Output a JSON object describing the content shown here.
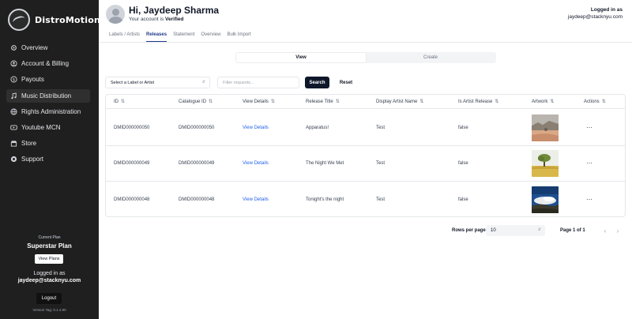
{
  "app": {
    "name": "DistroMotion",
    "logo_icon": "record-disc-icon"
  },
  "sidebar": {
    "items": [
      {
        "label": "Overview",
        "icon": "gear-icon",
        "active": false
      },
      {
        "label": "Account & Billing",
        "icon": "account-icon",
        "active": false
      },
      {
        "label": "Payouts",
        "icon": "dollar-icon",
        "active": false
      },
      {
        "label": "Music Distribution",
        "icon": "music-note-icon",
        "active": true
      },
      {
        "label": "Rights Administration",
        "icon": "globe-icon",
        "active": false
      },
      {
        "label": "Youtube MCN",
        "icon": "youtube-icon",
        "active": false
      },
      {
        "label": "Store",
        "icon": "store-icon",
        "active": false
      },
      {
        "label": "Support",
        "icon": "support-icon",
        "active": false
      }
    ],
    "plan_caption": "Current Plan",
    "plan_name": "Superstar Plan",
    "view_plans_label": "View Plans",
    "logged_in_caption": "Logged in as",
    "logged_in_email": "jaydeep@stacknyu.com",
    "logout_label": "Logout",
    "version": "Version Tag: 0.1.4.90"
  },
  "header": {
    "greeting": "Hi, Jaydeep Sharma",
    "status_prefix": "Your account is ",
    "status_value": "Verified",
    "logged_in_caption": "Logged in as",
    "logged_in_email": "jaydeep@stacknyu.com"
  },
  "tabs": [
    {
      "label": "Labels / Artists",
      "active": false
    },
    {
      "label": "Releases",
      "active": true
    },
    {
      "label": "Statement",
      "active": false
    },
    {
      "label": "Overview",
      "active": false
    },
    {
      "label": "Bulk Import",
      "active": false
    }
  ],
  "segmented": {
    "view_label": "View",
    "create_label": "Create",
    "selected": "View"
  },
  "filters": {
    "select_value": "Select a Label or Artist",
    "search_placeholder": "Filter requests...",
    "search_value": "",
    "search_label": "Search",
    "reset_label": "Reset"
  },
  "table": {
    "columns": [
      {
        "label": "ID",
        "sortable": true
      },
      {
        "label": "Catalogue ID",
        "sortable": true
      },
      {
        "label": "View Details",
        "sortable": true
      },
      {
        "label": "Release Title",
        "sortable": true
      },
      {
        "label": "Display Artist Name",
        "sortable": true
      },
      {
        "label": "Is Artist Release",
        "sortable": true
      },
      {
        "label": "Artwork",
        "sortable": true
      },
      {
        "label": "Actions",
        "sortable": true
      }
    ],
    "rows": [
      {
        "id": "DMID000000050",
        "catalogue_id": "DMID000000050",
        "view_details": "View Details",
        "release_title": "Apparatus!",
        "artist": "Test",
        "is_artist_release": "false",
        "artwork": "desert-landscape",
        "actions": "⋯"
      },
      {
        "id": "DMID000000049",
        "catalogue_id": "DMID000000049",
        "view_details": "View Details",
        "release_title": "The Night We Met",
        "artist": "Test",
        "is_artist_release": "false",
        "artwork": "tree-in-field",
        "actions": "⋯"
      },
      {
        "id": "DMID000000048",
        "catalogue_id": "DMID000000048",
        "view_details": "View Details",
        "release_title": "Tonight's the night",
        "artist": "Test",
        "is_artist_release": "false",
        "artwork": "sky-over-hills",
        "actions": "⋯"
      }
    ]
  },
  "pagination": {
    "rows_per_page_label": "Rows per page",
    "rows_per_page_value": "10",
    "page_info": "Page 1 of 1",
    "prev_icon": "chevron-left-icon",
    "next_icon": "chevron-right-icon"
  },
  "colors": {
    "sidebar_bg": "#1f1f1f",
    "accent_blue": "#1f3a8a",
    "link_blue": "#2563eb",
    "primary_button": "#0f172a"
  }
}
